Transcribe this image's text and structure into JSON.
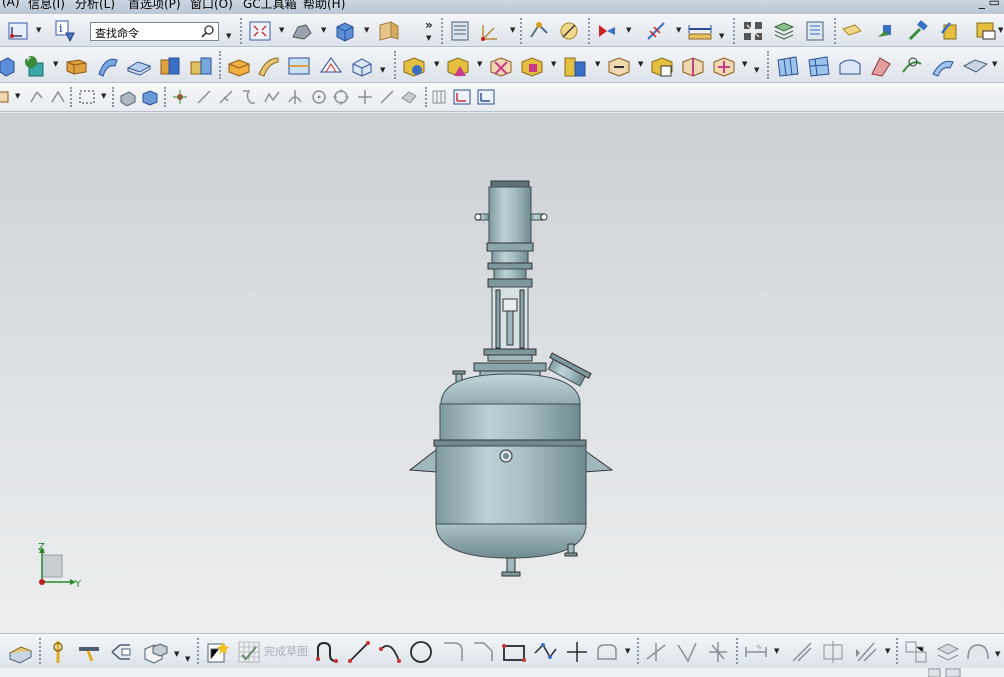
{
  "menubar": {
    "items": [
      "(A)",
      "信息(I)",
      "分析(L)",
      "首选项(P)",
      "窗口(O)",
      "GC工具箱",
      "帮助(H)"
    ],
    "window_controls": "_ ▭"
  },
  "toolbar1": {
    "search_placeholder": "查找命令",
    "overflow_label": "»"
  },
  "toolbar2": {},
  "toolbar3": {},
  "viewport": {
    "triad": {
      "z_label": "Z",
      "y_label": "Y"
    },
    "model": "reactor-vessel"
  },
  "bottom_toolbar": {
    "finish_sketch_label": "完成草图"
  },
  "colors": {
    "toolbar_bg": "#e6ebf0",
    "viewport_top": "#cbd0d4",
    "viewport_bottom": "#eceeef",
    "model_body": "#a9c3c8",
    "triad_z": "#2a8a2a",
    "triad_y": "#2a8a2a",
    "triad_x": "#c02020"
  }
}
